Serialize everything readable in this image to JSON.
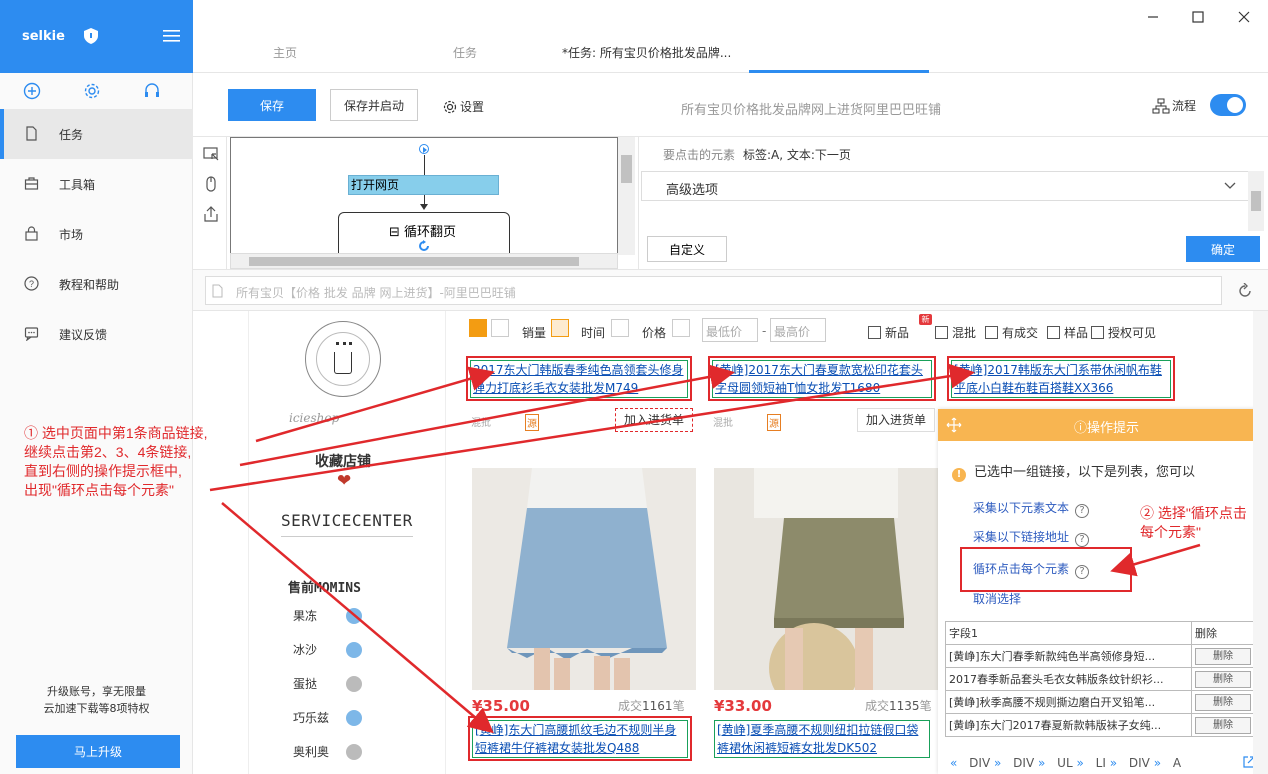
{
  "sidebar": {
    "brand": "selkie",
    "nav": [
      {
        "label": "任务",
        "icon": "document-icon",
        "active": true
      },
      {
        "label": "工具箱",
        "icon": "toolbox-icon",
        "active": false
      },
      {
        "label": "市场",
        "icon": "bag-icon",
        "active": false
      },
      {
        "label": "教程和帮助",
        "icon": "help-icon",
        "active": false
      },
      {
        "label": "建议反馈",
        "icon": "chat-icon",
        "active": false
      }
    ],
    "upgrade_line1": "升级账号，享无限量",
    "upgrade_line2": "云加速下载等8项特权",
    "upgrade_button": "马上升级"
  },
  "tabs": [
    {
      "label": "主页"
    },
    {
      "label": "任务"
    },
    {
      "label": "*任务: 所有宝贝价格批发品牌..."
    }
  ],
  "toolbar": {
    "save": "保存",
    "save_run": "保存并启动",
    "settings": "设置",
    "title": "所有宝贝价格批发品牌网上进货阿里巴巴旺铺",
    "flow": "流程"
  },
  "flowchart": {
    "open_page": "打开网页",
    "loop": "循环翻页"
  },
  "panel": {
    "element_label": "要点击的元素",
    "element_value": "标签:A, 文本:下一页",
    "advanced": "高级选项",
    "custom": "自定义",
    "confirm": "确定"
  },
  "url": {
    "text": "所有宝贝【价格 批发 品牌 网上进货】-阿里巴巴旺铺"
  },
  "shop": {
    "script": "icieshop",
    "favorite": "收藏店铺",
    "service": "SERVICECENTER",
    "presale": "售前MOMINS",
    "agents": [
      "果冻",
      "冰沙",
      "蛋挞",
      "巧乐兹",
      "奥利奥"
    ]
  },
  "filter": {
    "sales": "销量",
    "time": "时间",
    "price": "价格",
    "min_price": "最低价",
    "max_price": "最高价",
    "dash": "-",
    "new_badge": "新",
    "options": [
      "新品",
      "混批",
      "有成交",
      "样品",
      "授权可见"
    ]
  },
  "products_top": [
    {
      "title": "2017东大门韩版春季纯色高领套头修身弹力打底衫毛衣女装批发M749",
      "cart": "加入进货单"
    },
    {
      "title": "[黄峥]2017东大门春夏款宽松印花套头字母圆领短袖T恤女批发T1680",
      "cart": "加入进货单"
    },
    {
      "title": "[黄峥]2017韩版东大门系带休闲帆布鞋平底小白鞋布鞋百搭鞋XX366"
    }
  ],
  "mini_tags": [
    "混批",
    "源",
    "混批",
    "源"
  ],
  "products_bottom": [
    {
      "price": "¥35.00",
      "deal_prefix": "成交",
      "deal_num": "1161",
      "deal_suffix": "笔",
      "title": "[黄峥]东大门高腰抓纹毛边不规则半身短裤裙牛仔裤裙女装批发Q488"
    },
    {
      "price": "¥33.00",
      "deal_prefix": "成交",
      "deal_num": "1135",
      "deal_suffix": "笔",
      "title": "[黄峥]夏季高腰不规则纽扣拉链假口袋裤裙休闲裤短裤女批发DK502"
    }
  ],
  "tip": {
    "title": "操作提示",
    "message": "已选中一组链接，以下是列表，您可以",
    "options": [
      "采集以下元素文本",
      "采集以下链接地址",
      "循环点击每个元素",
      "取消选择"
    ],
    "qm": "?",
    "table_headers": [
      "字段1",
      "删除"
    ],
    "rows": [
      "[黄峥]东大门春季新款纯色半高领修身短...",
      "2017春季新品套头毛衣女韩版条纹针织衫...",
      "[黄峥]秋季高腰不规则撕边磨白开叉铅笔...",
      "[黄峥]东大门2017春夏新款韩版袜子女纯..."
    ],
    "delete_label": "删除",
    "path": [
      "«",
      "DIV",
      "»",
      "DIV",
      "»",
      "UL",
      "»",
      "LI",
      "»",
      "DIV",
      "»",
      "A"
    ]
  },
  "annotations": {
    "a1": [
      "① 选中页面中第1条商品链接,",
      "继续点击第2、3、4条链接,",
      "直到右侧的操作提示框中,",
      "出现\"循环点击每个元素\""
    ],
    "a2": [
      "② 选择\"循环点击",
      "每个元素\""
    ]
  },
  "colors": {
    "accent": "#2d8cf0",
    "annotation": "#e0292c",
    "tip_header": "#f8b551",
    "link_border": "#19a05a",
    "price": "#e4393c"
  }
}
